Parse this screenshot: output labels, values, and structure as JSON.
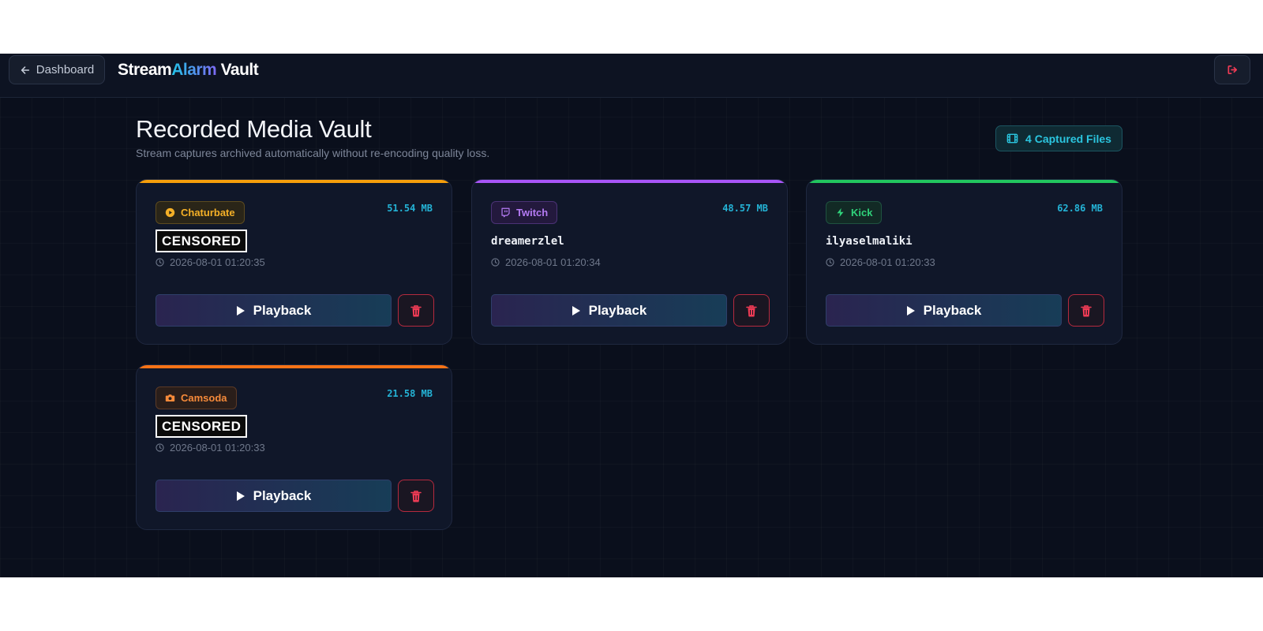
{
  "header": {
    "back_label": "Dashboard",
    "brand_part1": "Stream",
    "brand_part2": "Alarm",
    "brand_part3": " Vault"
  },
  "page": {
    "title": "Recorded Media Vault",
    "subtitle": "Stream captures archived automatically without re-encoding quality loss.",
    "files_badge": "4 Captured Files"
  },
  "recordings": [
    {
      "platform": "Chaturbate",
      "platform_icon": "play-circle-icon",
      "streamer": "CENSORED",
      "censored": true,
      "size": "51.54 MB",
      "timestamp": "2026-08-01 01:20:35",
      "play_label": "Playback",
      "accent": "#f59e0b",
      "badge_bg": "#2a2518",
      "badge_border": "#5c4a1f",
      "badge_color": "#f5b027"
    },
    {
      "platform": "Twitch",
      "platform_icon": "twitch-icon",
      "streamer": "dreamerzlel",
      "censored": false,
      "size": "48.57 MB",
      "timestamp": "2026-08-01 01:20:34",
      "play_label": "Playback",
      "accent": "#a855f7",
      "badge_bg": "#23193d",
      "badge_border": "#4a3275",
      "badge_color": "#b57bf5"
    },
    {
      "platform": "Kick",
      "platform_icon": "bolt-icon",
      "streamer": "ilyaselmaliki",
      "censored": false,
      "size": "62.86 MB",
      "timestamp": "2026-08-01 01:20:33",
      "play_label": "Playback",
      "accent": "#22c55e",
      "badge_bg": "#122a25",
      "badge_border": "#1f5240",
      "badge_color": "#2fd27a"
    },
    {
      "platform": "Camsoda",
      "platform_icon": "camera-icon",
      "streamer": "CENSORED",
      "censored": true,
      "size": "21.58 MB",
      "timestamp": "2026-08-01 01:20:33",
      "play_label": "Playback",
      "accent": "#f97316",
      "badge_bg": "#2a1e1a",
      "badge_border": "#5c3a26",
      "badge_color": "#f58a3a"
    }
  ]
}
